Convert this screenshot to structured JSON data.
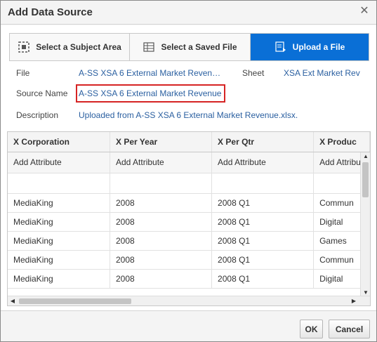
{
  "dialog": {
    "title": "Add Data Source"
  },
  "tabs": [
    {
      "label": "Select a Subject Area",
      "icon": "subject-area-icon",
      "active": false
    },
    {
      "label": "Select a Saved File",
      "icon": "saved-file-icon",
      "active": false
    },
    {
      "label": "Upload a File",
      "icon": "upload-file-icon",
      "active": true
    }
  ],
  "meta": {
    "file_label": "File",
    "file_value": "A-SS XSA 6 External Market Reven…",
    "sheet_label": "Sheet",
    "sheet_value": "XSA Ext Market Rev",
    "source_name_label": "Source Name",
    "source_name_value": "A-SS XSA 6 External Market Revenue",
    "description_label": "Description",
    "description_value": "Uploaded from A-SS XSA 6 External Market Revenue.xlsx."
  },
  "grid": {
    "headers": [
      "X Corporation",
      "X Per Year",
      "X Per Qtr",
      "X Produc"
    ],
    "attribute_label": "Add Attribute",
    "rows": [
      [
        "MediaKing",
        "2008",
        "2008 Q1",
        "Commun"
      ],
      [
        "MediaKing",
        "2008",
        "2008 Q1",
        "Digital"
      ],
      [
        "MediaKing",
        "2008",
        "2008 Q1",
        "Games"
      ],
      [
        "MediaKing",
        "2008",
        "2008 Q1",
        "Commun"
      ],
      [
        "MediaKing",
        "2008",
        "2008 Q1",
        "Digital"
      ]
    ]
  },
  "footer": {
    "ok_label": "OK",
    "cancel_label": "Cancel"
  },
  "colors": {
    "active_tab": "#0a6fd6",
    "link": "#2a5fa0",
    "highlight": "#d62424"
  }
}
